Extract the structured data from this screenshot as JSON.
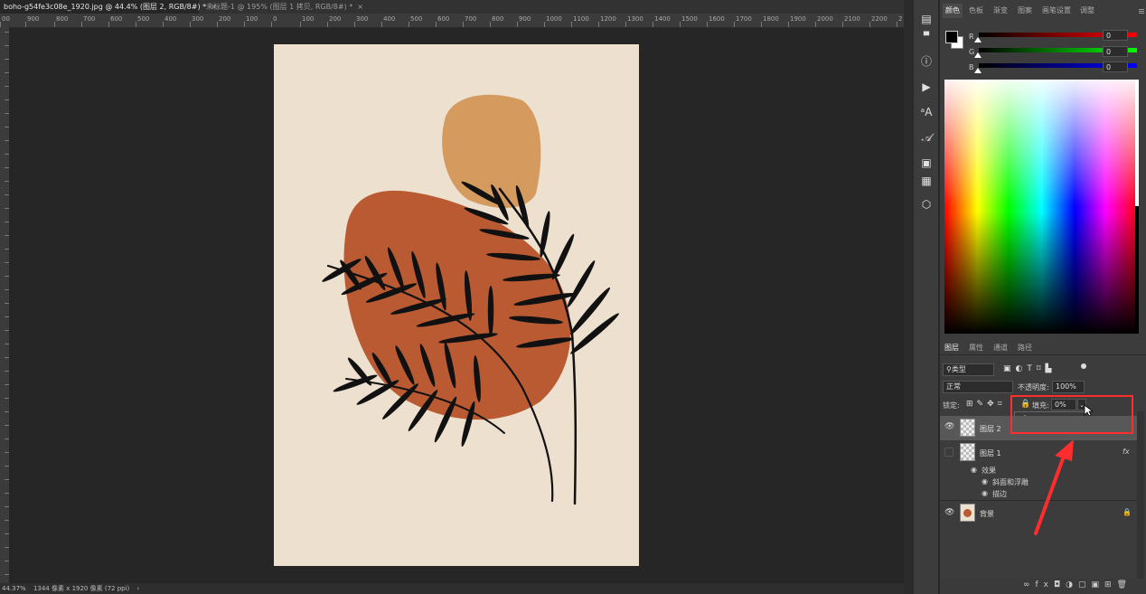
{
  "tabs": [
    {
      "label": "boho-g54fe3c08e_1920.jpg @ 44.4% (图层 2, RGB/8#) *",
      "close": "×"
    },
    {
      "label": "未标题-1 @ 195% (图层 1 拷贝, RGB/8#) *",
      "close": "×"
    }
  ],
  "ruler_labels": [
    "00",
    "900",
    "800",
    "700",
    "600",
    "500",
    "400",
    "300",
    "200",
    "100",
    "0",
    "100",
    "200",
    "300",
    "400",
    "500",
    "600",
    "700",
    "800",
    "900",
    "1000",
    "1100",
    "1200",
    "1300",
    "1400",
    "1500",
    "1600",
    "1700",
    "1800",
    "1900",
    "2000",
    "2100",
    "2200",
    "2"
  ],
  "status": {
    "zoom": "44.37%",
    "doc_size": "1344 像素 x 1920 像素 (72 ppi)",
    "arrow": "›"
  },
  "tools": [
    "layers-3d-icon",
    "info-icon",
    "play-icon",
    "character-icon",
    "paragraph-icon",
    "adjust-icon",
    "notes-icon",
    "cube-icon"
  ],
  "color_panel": {
    "tabs": [
      "颜色",
      "色板",
      "渐变",
      "图案",
      "画笔设置",
      "调整"
    ],
    "active_tab": "颜色",
    "r_label": "R",
    "g_label": "G",
    "b_label": "B",
    "r_value": "0",
    "g_value": "0",
    "b_value": "0",
    "fg_color": "#000000",
    "bg_color": "#ffffff"
  },
  "layers_panel": {
    "tabs": [
      "图层",
      "属性",
      "通道",
      "路径"
    ],
    "active_tab": "图层",
    "filter_kind": "类型",
    "blend_mode": "正常",
    "opacity_label": "不透明度:",
    "opacity_value": "100%",
    "lock_label": "锁定:",
    "fill_label": "填充:",
    "fill_value": "0%",
    "fill_slider_percent": 0,
    "layers": [
      {
        "name": "图层 2",
        "visible": true,
        "selected": true
      },
      {
        "name": "图层 1",
        "visible": false,
        "fx": "fx"
      },
      {
        "name": "背景",
        "visible": true,
        "locked": true
      }
    ],
    "effects_label": "效果",
    "effects": [
      "斜面和浮雕",
      "描边"
    ]
  },
  "colors": {
    "highlight": "#ff2d2d",
    "canvas_bg": "#ede0cf",
    "orange_blob": "#b95a33",
    "sand_blob": "#d49a5e"
  }
}
